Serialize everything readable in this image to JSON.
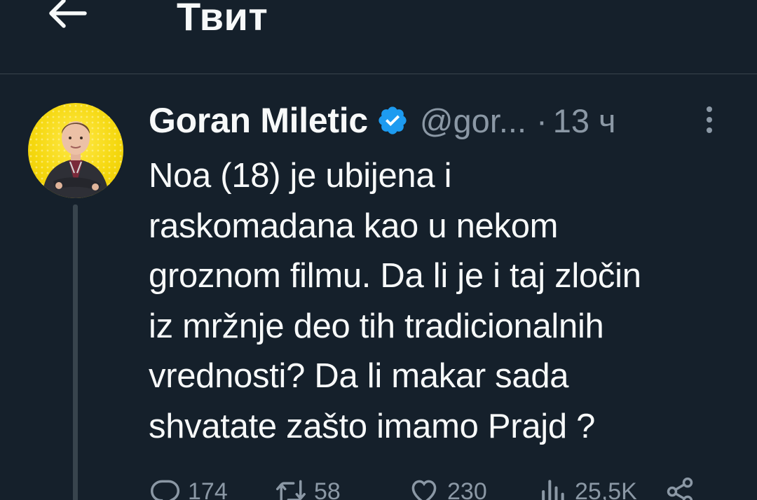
{
  "header": {
    "title": "Твит",
    "back_icon": "arrow-left-icon"
  },
  "tweet": {
    "author_name": "Goran Miletic",
    "verified_icon": "verified-badge-icon",
    "handle": "@gor...",
    "separator": "·",
    "time": "13 ч",
    "more_icon": "more-vertical-icon",
    "text": "Noa  (18) je ubijena i\nraskomadana kao u nekom\ngroznom filmu. Da li je i taj zločin\niz mržnje deo tih tradicionalnih\nvrednosti? Da li makar sada\nshvatate zašto imamo Prajd ?"
  },
  "actions": {
    "reply_count": "174",
    "retweet_count": "58",
    "like_count": "230",
    "views_count": "25,5K",
    "share_icon": "share-icon"
  },
  "colors": {
    "background": "#15202b",
    "text": "#f7f9f9",
    "secondary": "#8b98a5",
    "border": "#38444d",
    "verified": "#1d9bf0",
    "avatar_bg": "#f5d80f"
  }
}
